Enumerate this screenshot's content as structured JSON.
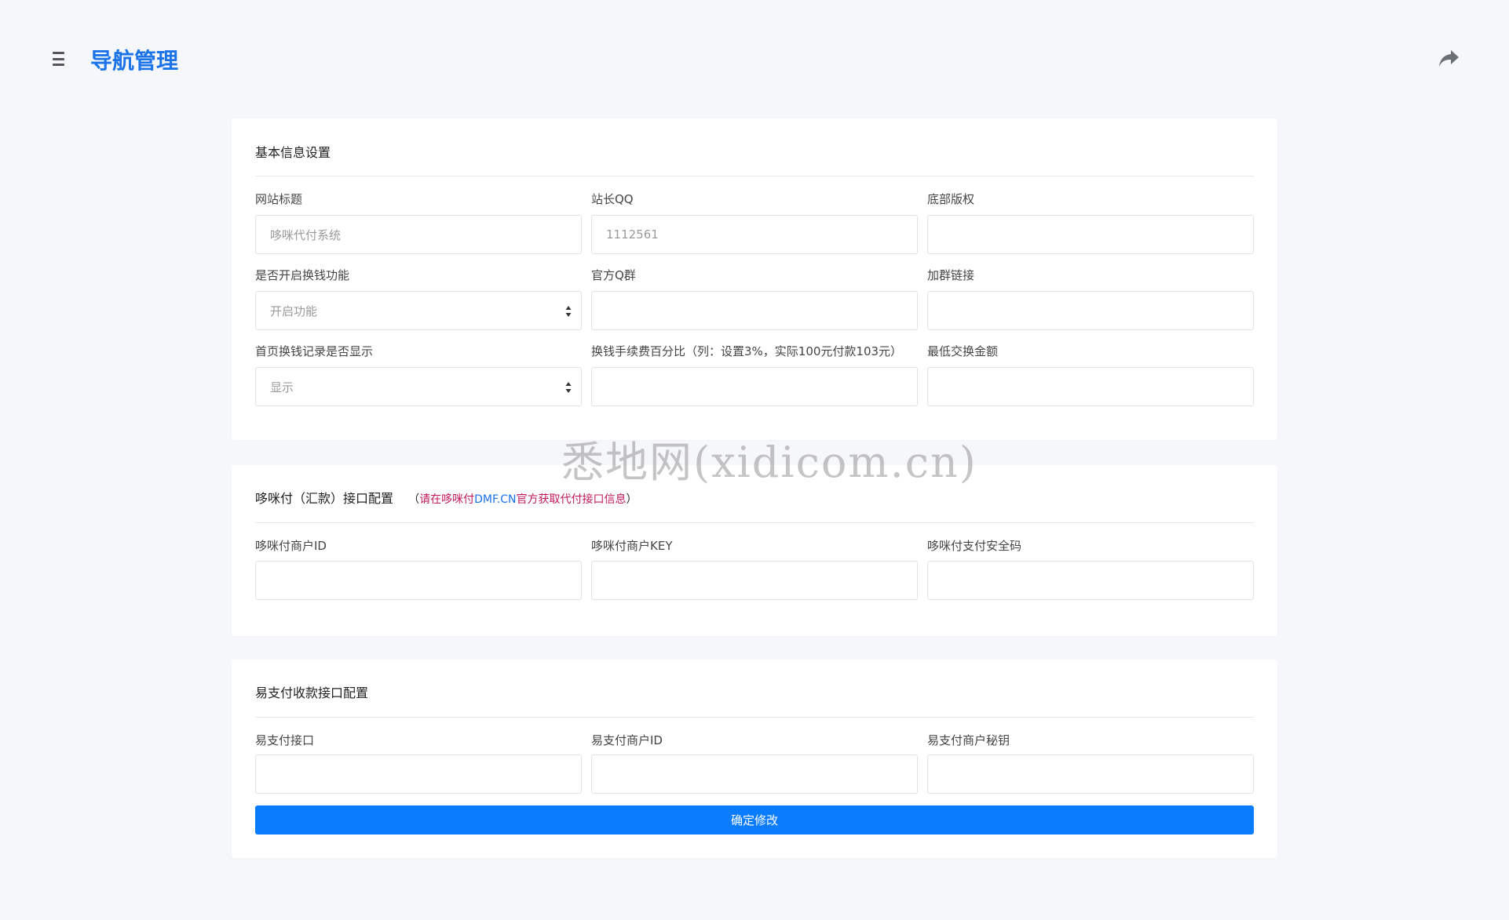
{
  "header": {
    "title": "导航管理",
    "menu_icon": "hamburger-icon",
    "share_icon": "share-icon"
  },
  "basic": {
    "title": "基本信息设置",
    "site_title_label": "网站标题",
    "site_title_placeholder": "哆咪代付系统",
    "qq_label": "站长QQ",
    "qq_placeholder": "1112561",
    "copyright_label": "底部版权",
    "exchange_label": "是否开启换钱功能",
    "exchange_value": "开启功能",
    "qgroup_label": "官方Q群",
    "grouplink_label": "加群链接",
    "record_label": "首页换钱记录是否显示",
    "record_value": "显示",
    "fee_label": "换钱手续费百分比（列：设置3%，实际100元付款103元）",
    "min_label": "最低交换金额"
  },
  "dmf": {
    "title": "哆咪付（汇款）接口配置",
    "hint_open": "（",
    "hint_red1": "请在哆咪付",
    "hint_blue": "DMF.CN",
    "hint_red2": "官方获取代付接口信息",
    "hint_close": "）",
    "merchant_id_label": "哆咪付商户ID",
    "merchant_key_label": "哆咪付商户KEY",
    "security_label": "哆咪付支付安全码"
  },
  "epay": {
    "title": "易支付收款接口配置",
    "api_label": "易支付接口",
    "merchant_id_label": "易支付商户ID",
    "secret_label": "易支付商户秘钥",
    "submit_label": "确定修改"
  },
  "watermark": "悉地网(xidicom.cn)",
  "colors": {
    "accent": "#1a73e8",
    "button": "#0a7cff",
    "background": "#f5f7fb",
    "hint_red": "#c2185b"
  }
}
